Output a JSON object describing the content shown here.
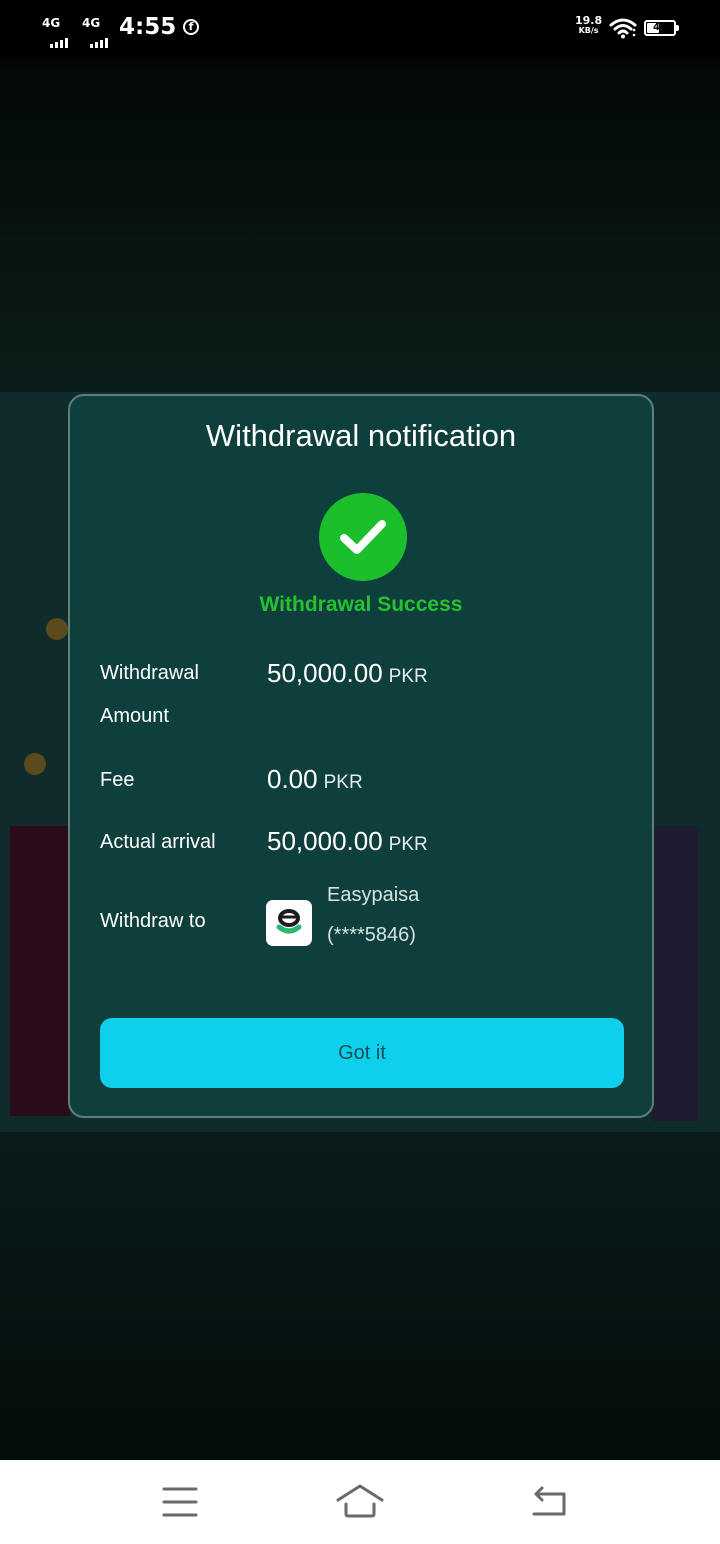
{
  "status_bar": {
    "network_1": "4G",
    "network_2": "4G",
    "time": "4:55",
    "notification_icon": "facebook-icon",
    "net_speed_value": "19.8",
    "net_speed_unit": "KB/s",
    "wifi_icon": "wifi-icon",
    "battery_level": "41"
  },
  "dialog": {
    "title": "Withdrawal notification",
    "status_icon": "check-circle-icon",
    "status_text": "Withdrawal Success",
    "status_color": "#26c22e",
    "rows": [
      {
        "label_line1": "Withdrawal",
        "label_line2": "Amount",
        "value": "50,000.00",
        "currency": "PKR"
      },
      {
        "label": "Fee",
        "value": "0.00",
        "currency": "PKR"
      },
      {
        "label": "Actual arrival",
        "value": "50,000.00",
        "currency": "PKR"
      }
    ],
    "withdraw_to": {
      "label": "Withdraw to",
      "method_icon": "easypaisa-logo-icon",
      "method_name": "Easypaisa",
      "account": "(****5846)"
    },
    "confirm_button": "Got it",
    "accent_color": "#0fd0ec"
  },
  "nav_bar": {
    "menu_icon": "menu-icon",
    "home_icon": "home-icon",
    "back_icon": "back-icon"
  }
}
